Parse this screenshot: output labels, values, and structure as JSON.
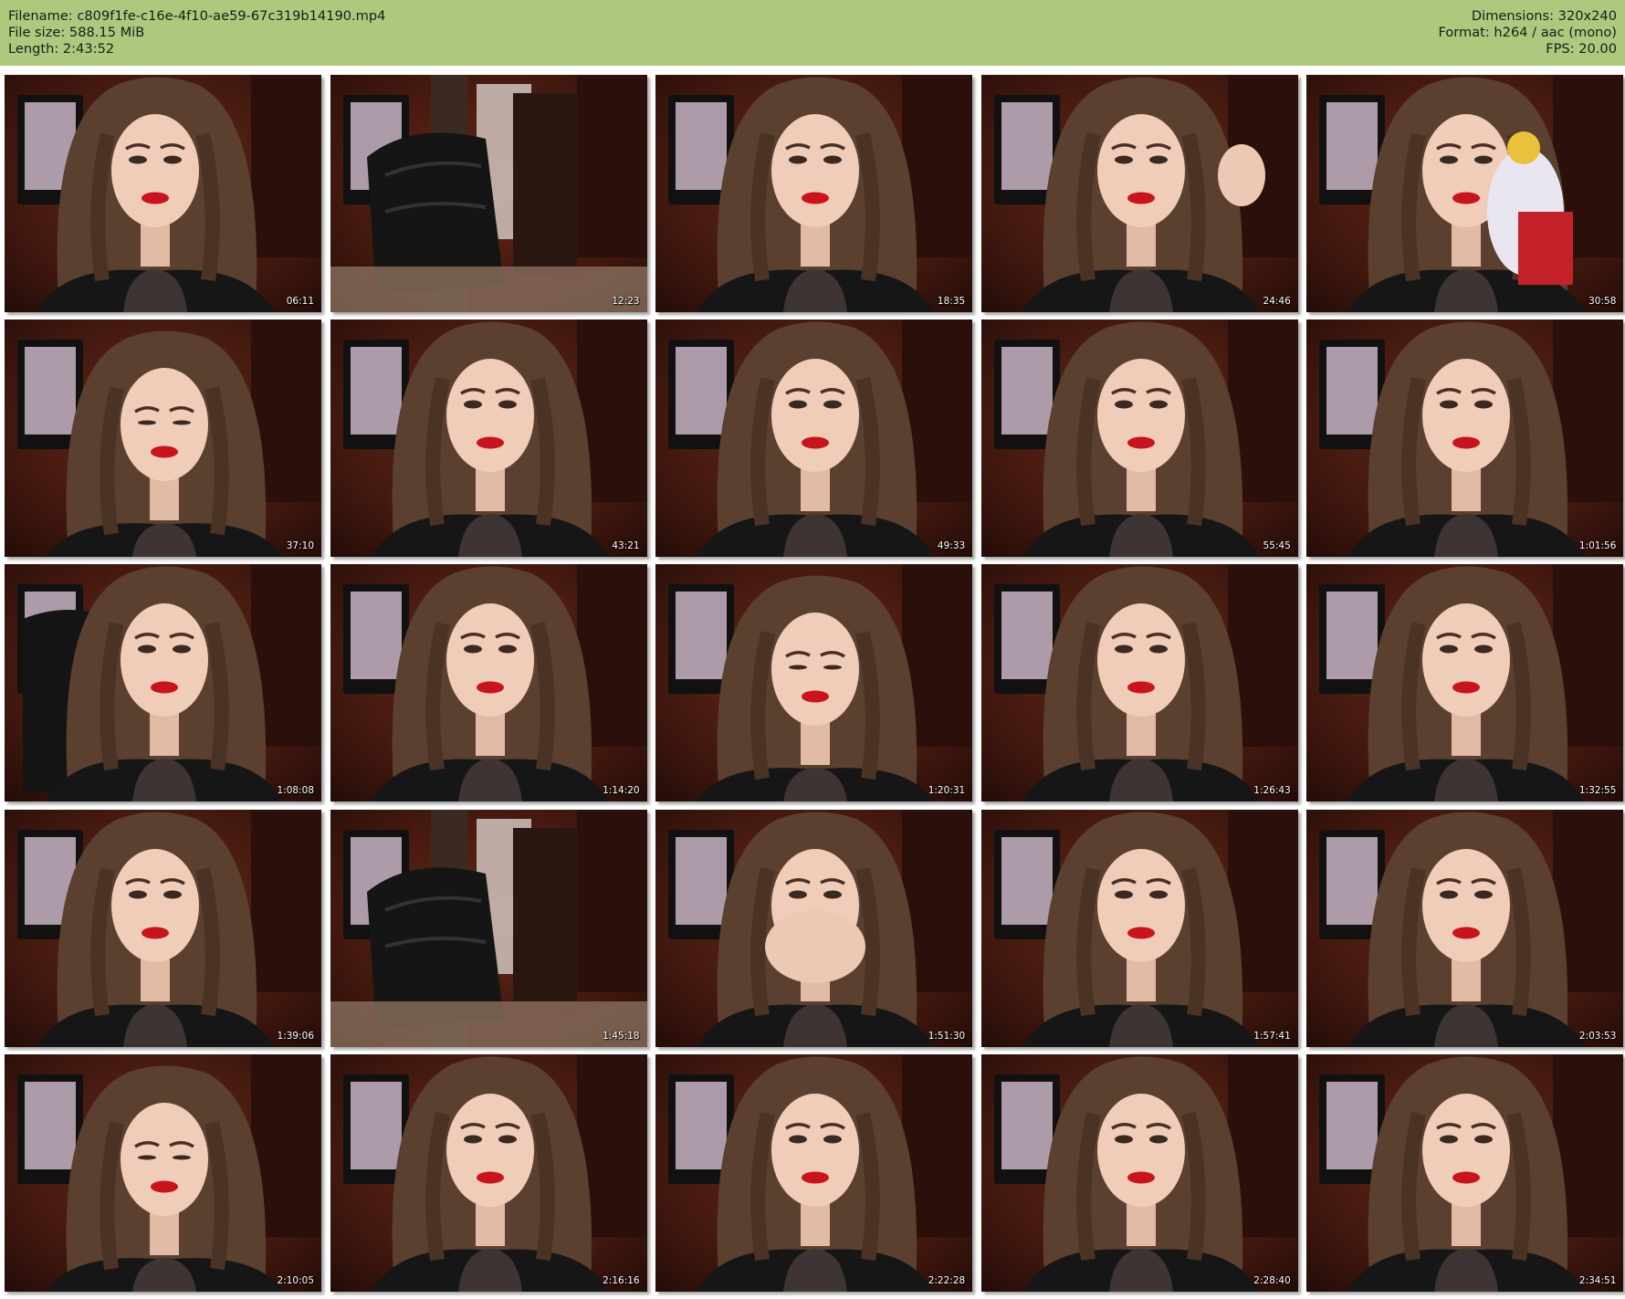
{
  "header": {
    "filename": "Filename: c809f1fe-c16e-4f10-ae59-67c319b14190.mp4",
    "file_size": "File size: 588.15 MiB",
    "length": "Length: 2:43:52",
    "dimensions": "Dimensions: 320x240",
    "format": "Format: h264 / aac (mono)",
    "fps": "FPS: 20.00"
  },
  "colors": {
    "header_bg": "#adc97d",
    "page_bg": "#ffffff"
  },
  "thumbnails": [
    {
      "time": "06:11",
      "scene": "face-left"
    },
    {
      "time": "12:23",
      "scene": "chair"
    },
    {
      "time": "18:35",
      "scene": "face-center"
    },
    {
      "time": "24:46",
      "scene": "face-hand"
    },
    {
      "time": "30:58",
      "scene": "face-toy"
    },
    {
      "time": "37:10",
      "scene": "face-down"
    },
    {
      "time": "43:21",
      "scene": "face-center"
    },
    {
      "time": "49:33",
      "scene": "face-center"
    },
    {
      "time": "55:45",
      "scene": "face-center"
    },
    {
      "time": "1:01:56",
      "scene": "face-center"
    },
    {
      "time": "1:08:08",
      "scene": "face-chair"
    },
    {
      "time": "1:14:20",
      "scene": "face-center"
    },
    {
      "time": "1:20:31",
      "scene": "face-down"
    },
    {
      "time": "1:26:43",
      "scene": "face-center"
    },
    {
      "time": "1:32:55",
      "scene": "face-center"
    },
    {
      "time": "1:39:06",
      "scene": "face-left"
    },
    {
      "time": "1:45:18",
      "scene": "chair"
    },
    {
      "time": "1:51:30",
      "scene": "face-hands"
    },
    {
      "time": "1:57:41",
      "scene": "face-center"
    },
    {
      "time": "2:03:53",
      "scene": "face-center"
    },
    {
      "time": "2:10:05",
      "scene": "face-down"
    },
    {
      "time": "2:16:16",
      "scene": "face-center"
    },
    {
      "time": "2:22:28",
      "scene": "face-center"
    },
    {
      "time": "2:28:40",
      "scene": "face-center"
    },
    {
      "time": "2:34:51",
      "scene": "face-center"
    }
  ]
}
